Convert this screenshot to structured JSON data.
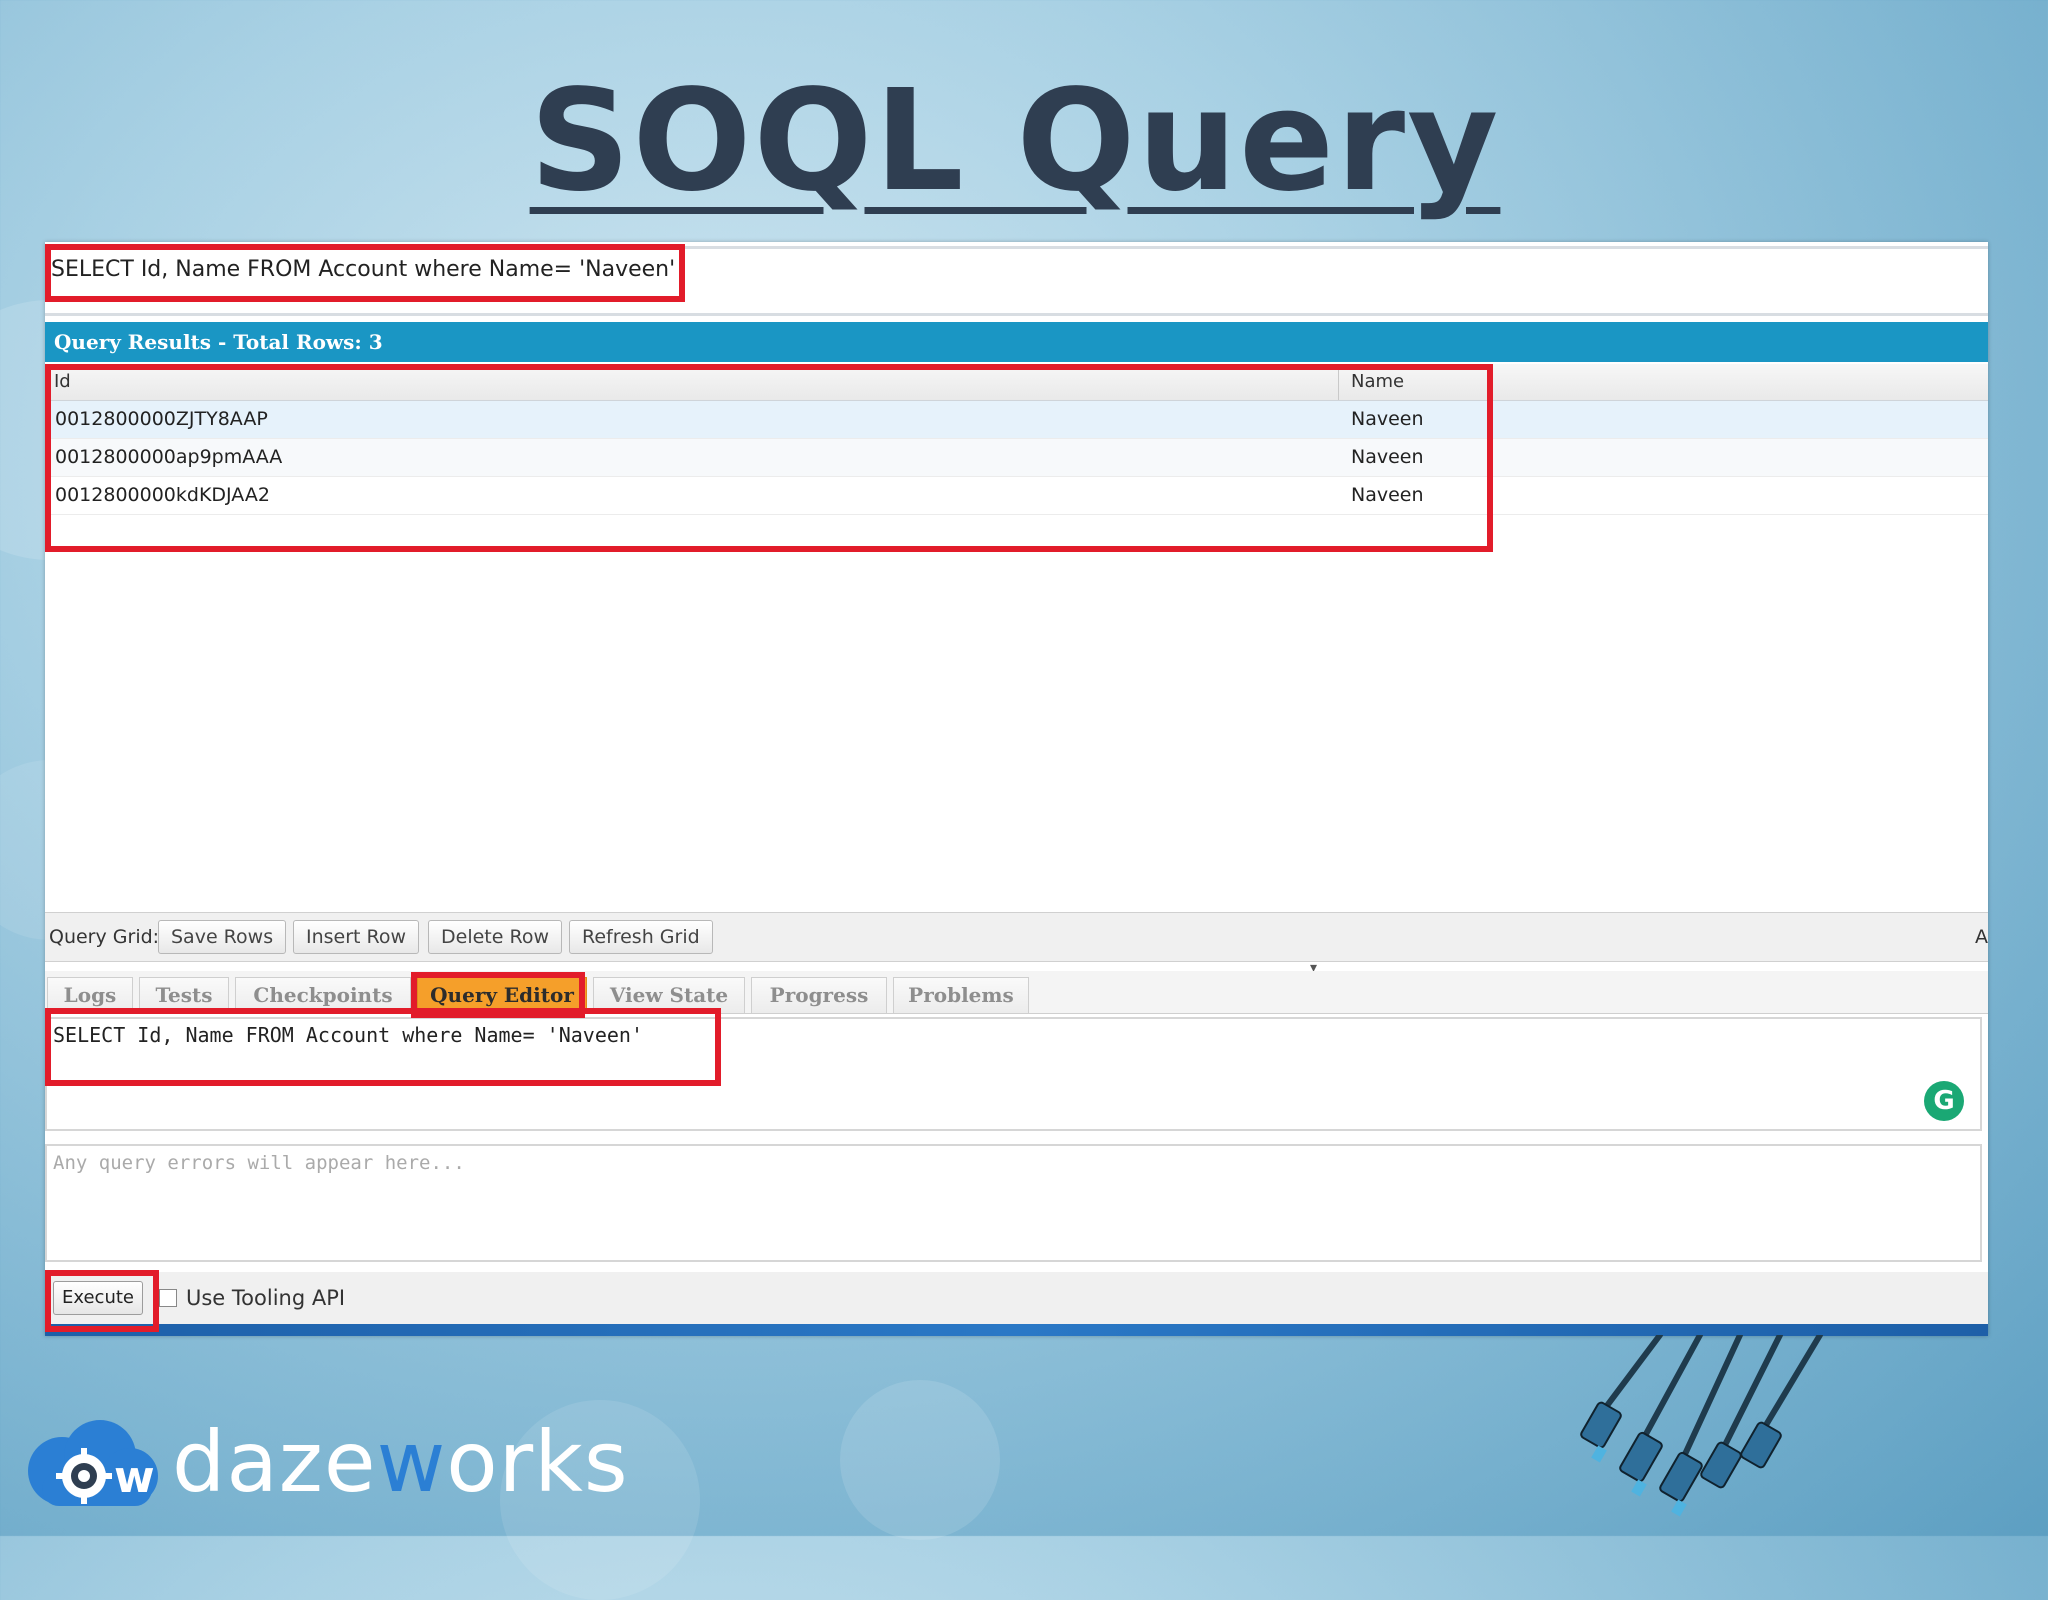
{
  "slide": {
    "title": "SOQL Query"
  },
  "top_query": {
    "text": "SELECT Id, Name FROM Account where Name= 'Naveen'"
  },
  "results": {
    "header": "Query Results - Total Rows: 3",
    "columns": [
      "Id",
      "Name"
    ],
    "rows": [
      {
        "id": "0012800000ZJTY8AAP",
        "name": "Naveen"
      },
      {
        "id": "0012800000ap9pmAAA",
        "name": "Naveen"
      },
      {
        "id": "0012800000kdKDJAA2",
        "name": "Naveen"
      }
    ]
  },
  "grid_toolbar": {
    "label": "Query Grid:",
    "buttons": [
      "Save Rows",
      "Insert Row",
      "Delete Row",
      "Refresh Grid"
    ],
    "right_text": "A"
  },
  "tabs": [
    {
      "label": "Logs",
      "active": false
    },
    {
      "label": "Tests",
      "active": false
    },
    {
      "label": "Checkpoints",
      "active": false
    },
    {
      "label": "Query Editor",
      "active": true
    },
    {
      "label": "View State",
      "active": false
    },
    {
      "label": "Progress",
      "active": false
    },
    {
      "label": "Problems",
      "active": false
    }
  ],
  "editor": {
    "text": "SELECT Id, Name FROM Account where Name= 'Naveen'",
    "badge_icon": "grammarly-icon",
    "badge_letter": "G"
  },
  "errors": {
    "placeholder": "Any query errors will appear here..."
  },
  "execute_bar": {
    "execute_label": "Execute",
    "tooling_label": "Use Tooling API",
    "tooling_checked": false
  },
  "brand": {
    "logo_text_prefix": "daze",
    "logo_text_accent": "w",
    "logo_text_suffix": "orks",
    "accent_color": "#2b7fd4",
    "highlight_color": "#e21c2a",
    "results_bar_color": "#1a96c4",
    "active_tab_color": "#f59f2a"
  }
}
